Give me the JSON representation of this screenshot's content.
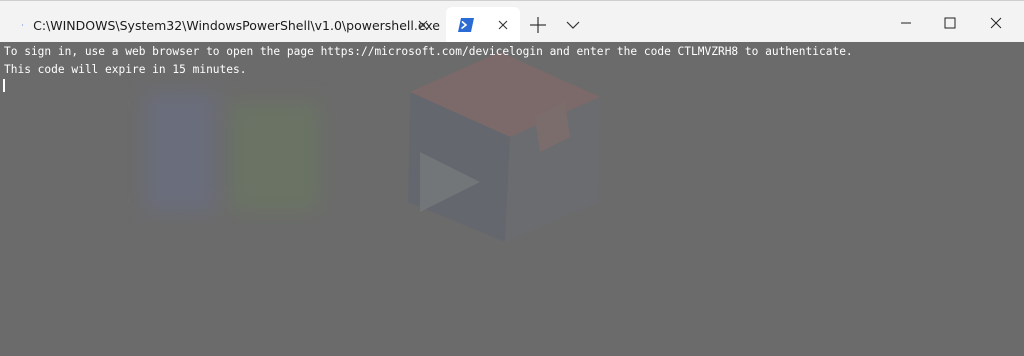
{
  "tabs": [
    {
      "title": "C:\\WINDOWS\\System32\\WindowsPowerShell\\v1.0\\powershell.exe"
    },
    {
      "title": ""
    }
  ],
  "icons": {
    "powershell": "powershell-icon",
    "close": "close-icon",
    "new_tab": "plus-icon",
    "dropdown": "chevron-down-icon",
    "minimize": "minimize-icon",
    "maximize": "maximize-icon",
    "window_close": "close-icon"
  },
  "terminal": {
    "line1": "To sign in, use a web browser to open the page https://microsoft.com/devicelogin and enter the code CTLMVZRH8 to authenticate.",
    "line2": "This code will expire in 15 minutes."
  },
  "colors": {
    "titlebar_bg": "#f3f3f3",
    "active_tab_bg": "#ffffff",
    "terminal_bg": "#6b6b6b",
    "terminal_text": "#ffffff",
    "powershell_icon": "#2b6cd4"
  }
}
